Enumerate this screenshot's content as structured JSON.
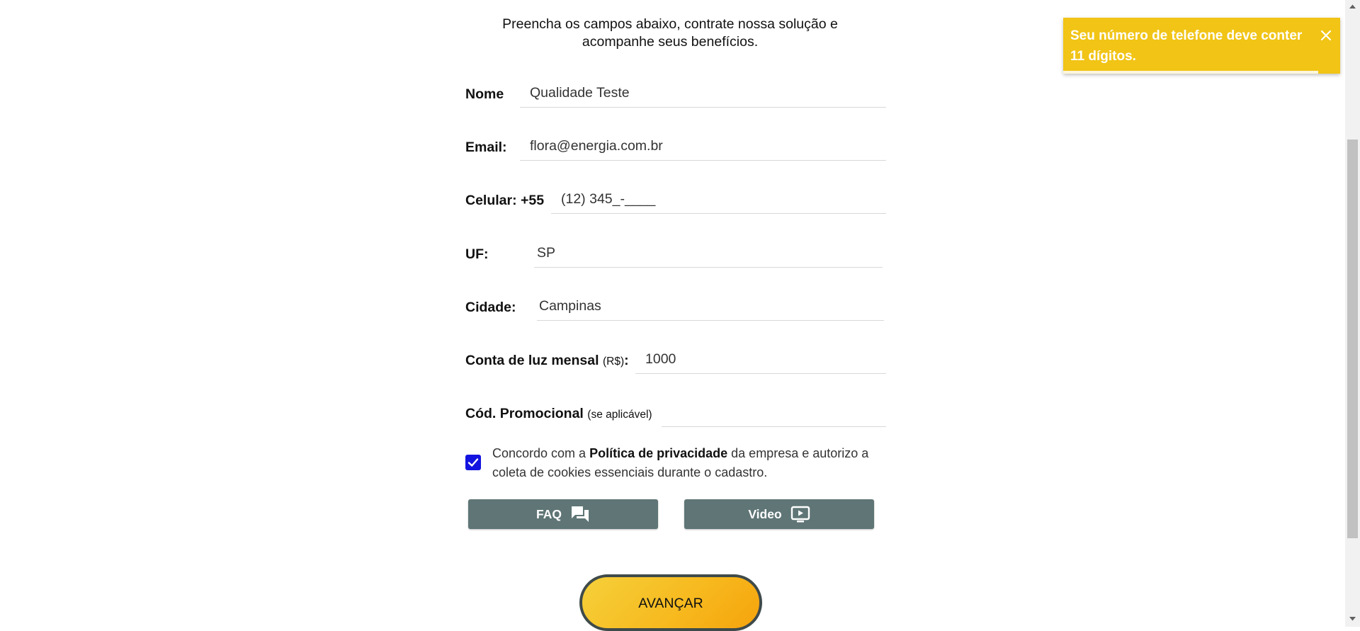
{
  "intro": {
    "line1": "Preencha os campos abaixo, contrate nossa solução e",
    "line2": "acompanhe seus benefícios."
  },
  "form": {
    "name_label": "Nome",
    "name_value": "Qualidade Teste",
    "email_label": "Email:",
    "email_value": "flora@energia.com.br",
    "phone_label": "Celular: +55",
    "phone_value": "(12) 345_-____",
    "uf_label": "UF:",
    "uf_value": "SP",
    "city_label": "Cidade:",
    "city_value": "Campinas",
    "bill_label": "Conta de luz mensal",
    "bill_unit": "(R$)",
    "bill_colon": ":",
    "bill_value": "1000",
    "promo_label": "Cód. Promocional",
    "promo_note": "(se aplicável)",
    "promo_value": ""
  },
  "consent": {
    "checked": true,
    "text_prefix": "Concordo com a ",
    "policy_link": "Política de privacidade",
    "text_suffix": " da empresa e autorizo a coleta de cookies essenciais durante o cadastro."
  },
  "buttons": {
    "faq_label": "FAQ",
    "faq_icon": "chat-bubbles-icon",
    "video_label": "Video",
    "video_icon": "play-screen-icon",
    "advance_label": "AVANÇAR"
  },
  "toast": {
    "message": "Seu número de telefone deve conter 11 dígitos.",
    "close_icon": "close-icon",
    "color": "#f1c416"
  },
  "colors": {
    "secondary_button": "#5f7576",
    "checkbox": "#1414e0",
    "advance_start": "#f5d03a",
    "advance_end": "#f6a30c"
  }
}
